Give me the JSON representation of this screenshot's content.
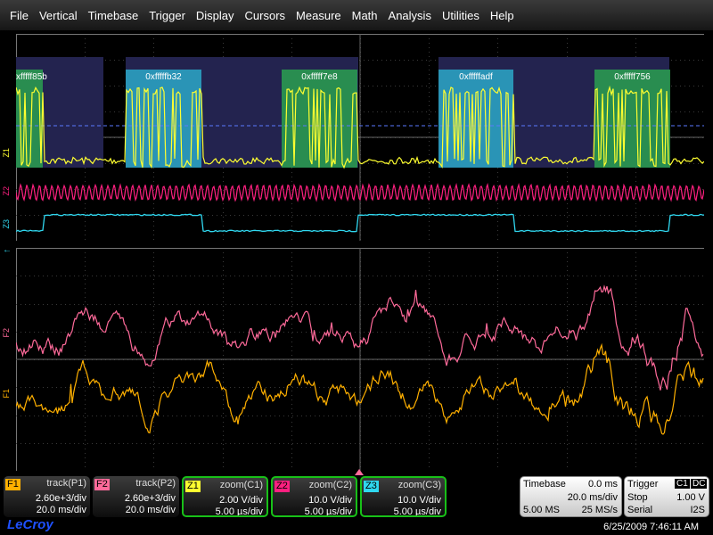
{
  "menu": [
    "File",
    "Vertical",
    "Timebase",
    "Trigger",
    "Display",
    "Cursors",
    "Measure",
    "Math",
    "Analysis",
    "Utilities",
    "Help"
  ],
  "decode_labels": [
    "xfffff85b",
    "0xfffffb32",
    "0xfffff7e8",
    "0xfffffadf",
    "0xfffff756"
  ],
  "channel_labels": {
    "z1": "Z1",
    "z2": "Z2",
    "z3": "Z3",
    "f2": "F2",
    "f1": "F1"
  },
  "colors": {
    "z1": "#ffff30",
    "z2": "#ff2080",
    "z3": "#30d8f0",
    "f1": "#ffb000",
    "f2": "#ff6a9a",
    "decode_blue": "#2ba8c8",
    "decode_green": "#2aa050",
    "decode_band": "#23234f"
  },
  "panels": [
    {
      "badge": "F1",
      "name": "track(P1)",
      "line1": "2.60e+3/div",
      "line2": "20.0 ms/div",
      "color": "#ffb000",
      "zoom": false
    },
    {
      "badge": "F2",
      "name": "track(P2)",
      "line1": "2.60e+3/div",
      "line2": "20.0 ms/div",
      "color": "#ff6a9a",
      "zoom": false
    },
    {
      "badge": "Z1",
      "name": "zoom(C1)",
      "line1": "2.00 V/div",
      "line2": "5.00 µs/div",
      "color": "#ffff30",
      "zoom": true
    },
    {
      "badge": "Z2",
      "name": "zoom(C2)",
      "line1": "10.0 V/div",
      "line2": "5.00 µs/div",
      "color": "#ff2080",
      "zoom": true
    },
    {
      "badge": "Z3",
      "name": "zoom(C3)",
      "line1": "10.0 V/div",
      "line2": "5.00 µs/div",
      "color": "#30d8f0",
      "zoom": true
    }
  ],
  "timebase": {
    "label": "Timebase",
    "offset": "0.0 ms",
    "per_div": "20.0 ms/div",
    "samples": "5.00 MS",
    "rate": "25 MS/s"
  },
  "trigger": {
    "label": "Trigger",
    "source": "C1",
    "coupling": "DC",
    "mode": "Stop",
    "level": "1.00 V",
    "type": "Serial",
    "protocol": "I2S"
  },
  "brand": "LeCroy",
  "datetime": "6/25/2009 7:46:11 AM"
}
